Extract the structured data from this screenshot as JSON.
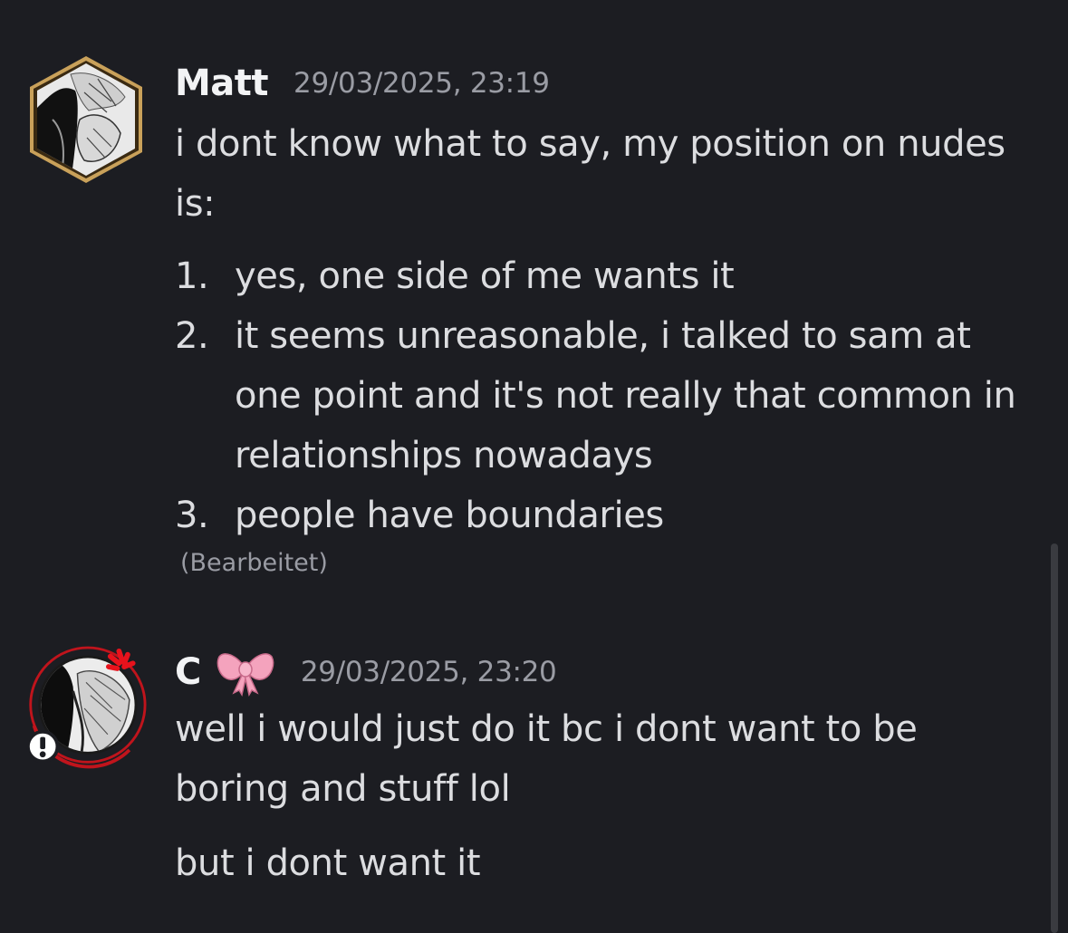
{
  "messages": [
    {
      "author": "Matt",
      "timestamp": "29/03/2025, 23:19",
      "avatar": "manga-portrait-hexagon-frame",
      "paragraph": "i dont know what to say, my position on nudes is:",
      "list": [
        {
          "num": "1.",
          "text": "yes, one side of me wants it"
        },
        {
          "num": "2.",
          "text": "it seems unreasonable, i talked to sam at one point and it's not really that common in relationships nowadays"
        },
        {
          "num": "3.",
          "text": "people have boundaries"
        }
      ],
      "edited": "(Bearbeitet)"
    },
    {
      "author": "C",
      "author_emoji": "pink-bow-icon",
      "timestamp": "29/03/2025, 23:20",
      "avatar": "manga-portrait-red-ring",
      "paragraphs": [
        "well i would just do it bc i dont want to be boring and stuff lol",
        "but i dont want it"
      ]
    }
  ],
  "colors": {
    "background": "#1c1d22",
    "text": "#dcdde0",
    "username": "#f2f3f5",
    "muted": "#9a9ca4",
    "hex_frame": "#c9a15a",
    "red_ring": "#c0141c",
    "bow": "#f4a3bd"
  }
}
